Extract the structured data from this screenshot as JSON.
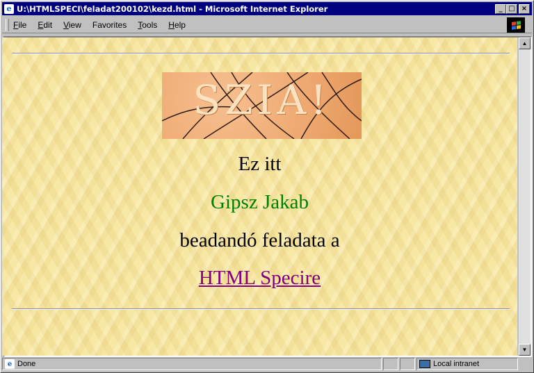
{
  "window": {
    "title": "U:\\HTMLSPECI\\feladat200102\\kezd.html - Microsoft Internet Explorer",
    "controls": {
      "minimize": "_",
      "maximize": "□",
      "close": "×"
    }
  },
  "menu": {
    "items": [
      {
        "label_ul": "F",
        "label_rest": "ile"
      },
      {
        "label_ul": "E",
        "label_rest": "dit"
      },
      {
        "label_ul": "V",
        "label_rest": "iew"
      },
      {
        "label_ul": "",
        "label_rest": "Favorites",
        "ul_mid": "a"
      },
      {
        "label_ul": "T",
        "label_rest": "ools"
      },
      {
        "label_ul": "H",
        "label_rest": "elp"
      }
    ]
  },
  "page": {
    "banner_text": "SZIA!",
    "line1": "Ez itt",
    "name": "Gipsz Jakab",
    "line3": "beadandó feladata a",
    "link": "HTML Specire",
    "colors": {
      "name": "#008000",
      "link": "#800080",
      "text": "#000000"
    }
  },
  "status": {
    "text": "Done",
    "zone": "Local intranet"
  },
  "icons": {
    "title": "ie-icon",
    "windows_logo": "windows-logo-icon",
    "status": "page-done-icon",
    "zone": "intranet-zone-icon"
  }
}
